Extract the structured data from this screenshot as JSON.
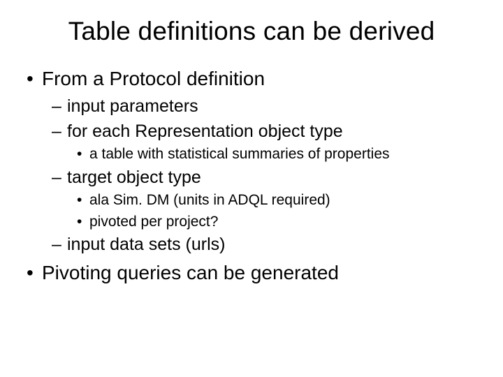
{
  "title": "Table definitions can be derived",
  "bullets": {
    "b1": "From a Protocol definition",
    "b1_1": "input parameters",
    "b1_2": "for each Representation object type",
    "b1_2_1": "a table with statistical summaries of properties",
    "b1_3": "target object type",
    "b1_3_1": "ala Sim. DM (units in ADQL required)",
    "b1_3_2": "pivoted per project?",
    "b1_4": "input data sets (urls)",
    "b2": "Pivoting queries can be generated"
  }
}
